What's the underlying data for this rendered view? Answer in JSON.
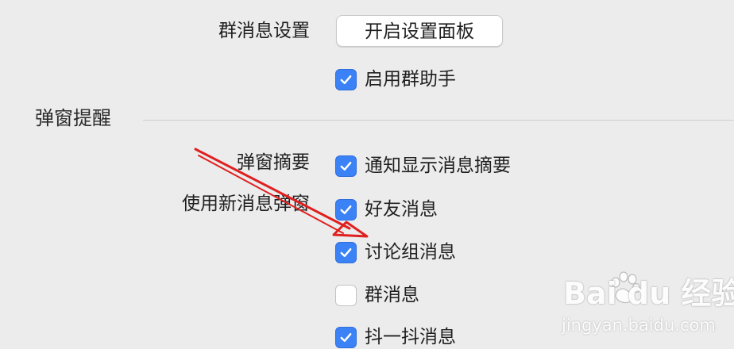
{
  "group_settings": {
    "label": "群消息设置",
    "button_label": "开启设置面板",
    "checkbox": {
      "label": "启用群助手",
      "checked": true
    }
  },
  "popup_section": {
    "title": "弹窗提醒",
    "summary_label": "弹窗摘要",
    "new_message_label": "使用新消息弹窗",
    "options": [
      {
        "label": "通知显示消息摘要",
        "checked": true
      },
      {
        "label": "好友消息",
        "checked": true
      },
      {
        "label": "讨论组消息",
        "checked": true
      },
      {
        "label": "群消息",
        "checked": false
      },
      {
        "label": "抖一抖消息",
        "checked": true
      }
    ]
  },
  "watermark": {
    "brand": "Bai du 经验",
    "url": "jingyan.baidu.com"
  },
  "colors": {
    "checkbox_on": "#3b82f6",
    "annotation_arrow": "#e02020"
  }
}
